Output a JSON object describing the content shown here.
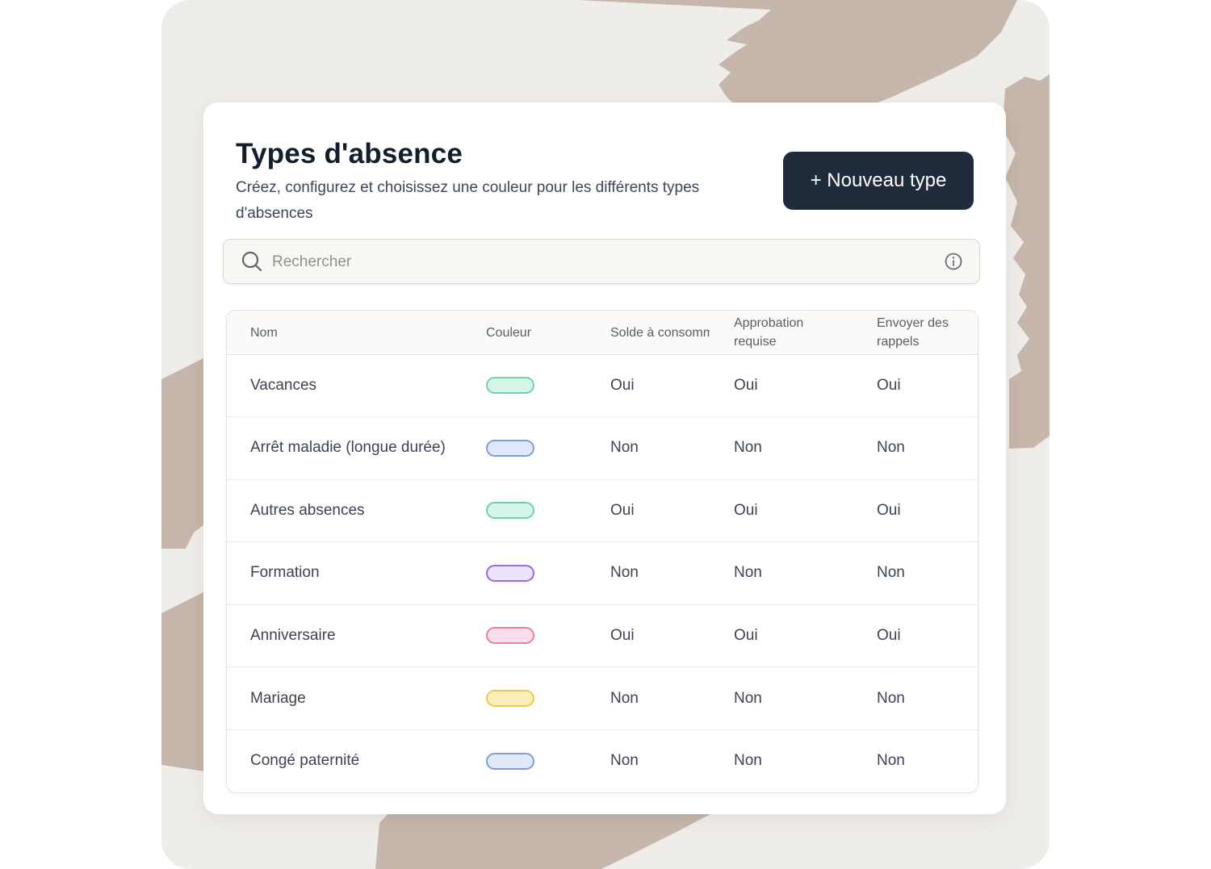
{
  "header": {
    "title": "Types d'absence",
    "subtitle": "Créez, configurez et choisissez une couleur pour les différents types d'absences",
    "new_button_label": "+ Nouveau type"
  },
  "search": {
    "placeholder": "Rechercher"
  },
  "table": {
    "columns": [
      "Nom",
      "Couleur",
      "Solde à consommer",
      "Approbation requise",
      "Envoyer des rappels"
    ],
    "rows": [
      {
        "name": "Vacances",
        "color_border": "#6fd3a9",
        "color_fill": "#d4f5e8",
        "solde": "Oui",
        "approbation": "Oui",
        "rappels": "Oui"
      },
      {
        "name": "Arrêt maladie (longue durée)",
        "color_border": "#7e9ae0",
        "color_fill": "#e1e8fa",
        "solde": "Non",
        "approbation": "Non",
        "rappels": "Non"
      },
      {
        "name": "Autres absences",
        "color_border": "#6fd3a9",
        "color_fill": "#d4f5e8",
        "solde": "Oui",
        "approbation": "Oui",
        "rappels": "Oui"
      },
      {
        "name": "Formation",
        "color_border": "#9a6ae0",
        "color_fill": "#ece3fb",
        "solde": "Non",
        "approbation": "Non",
        "rappels": "Non"
      },
      {
        "name": "Anniversaire",
        "color_border": "#e97ea9",
        "color_fill": "#fbe0ec",
        "solde": "Oui",
        "approbation": "Oui",
        "rappels": "Oui"
      },
      {
        "name": "Mariage",
        "color_border": "#f2c94c",
        "color_fill": "#fcefb8",
        "solde": "Non",
        "approbation": "Non",
        "rappels": "Non"
      },
      {
        "name": "Congé paternité",
        "color_border": "#7e9ae0",
        "color_fill": "#e1e8fa",
        "solde": "Non",
        "approbation": "Non",
        "rappels": "Non"
      }
    ]
  },
  "icons": {
    "search": "search-icon",
    "info": "info-icon"
  }
}
